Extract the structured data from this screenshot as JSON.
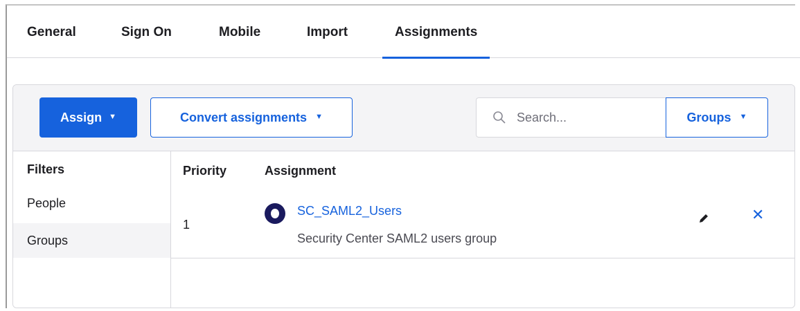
{
  "tabs": [
    {
      "label": "General"
    },
    {
      "label": "Sign On"
    },
    {
      "label": "Mobile"
    },
    {
      "label": "Import"
    },
    {
      "label": "Assignments",
      "active": true
    }
  ],
  "toolbar": {
    "assign_label": "Assign",
    "convert_label": "Convert assignments",
    "search_placeholder": "Search...",
    "search_value": "",
    "groups_label": "Groups",
    "caret": "▼"
  },
  "filters": {
    "title": "Filters",
    "items": [
      {
        "label": "People"
      },
      {
        "label": "Groups",
        "selected": true
      }
    ]
  },
  "table": {
    "columns": [
      "Priority",
      "Assignment"
    ],
    "rows": [
      {
        "priority": "1",
        "name": "SC_SAML2_Users",
        "description": "Security Center SAML2 users group",
        "icon": "group-icon"
      }
    ]
  },
  "colors": {
    "accent": "#1662dd",
    "group_icon": "#1a1a5e",
    "border": "#d7d7dc"
  }
}
